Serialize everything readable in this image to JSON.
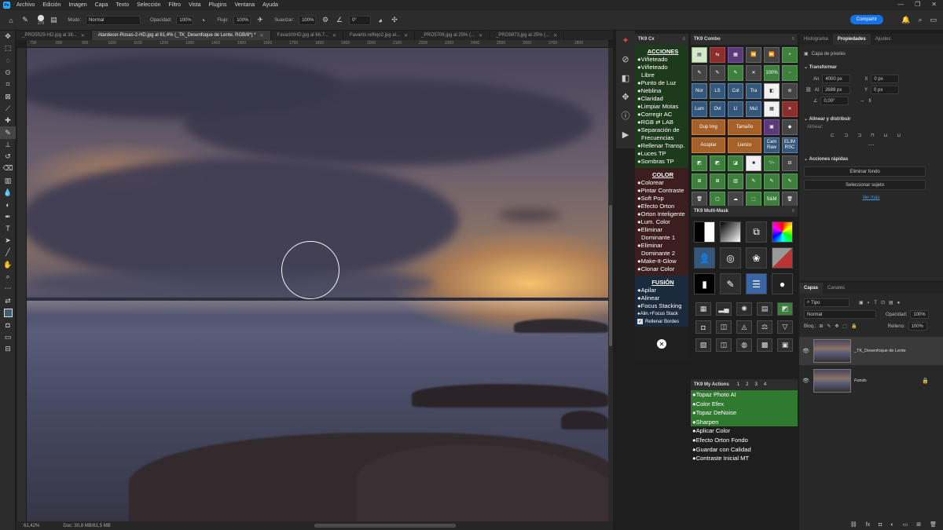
{
  "menubar": {
    "logo": "Ps",
    "items": [
      "Archivo",
      "Edición",
      "Imagen",
      "Capa",
      "Texto",
      "Selección",
      "Filtro",
      "Vista",
      "Plugins",
      "Ventana",
      "Ayuda"
    ]
  },
  "options": {
    "brush_size": "279",
    "mode_label": "Modo:",
    "mode_value": "Normal",
    "opacity_label": "Opacidad:",
    "opacity_value": "100%",
    "flow_label": "Flujo:",
    "flow_value": "100%",
    "smooth_label": "Suavizar:",
    "smooth_value": "100%",
    "angle_value": "0°",
    "share_label": "Compartir"
  },
  "doc_tabs": [
    {
      "label": "_PRO5529-HD.jpg al 38...",
      "active": false
    },
    {
      "label": "Atardecer-Rosas-2-HD.jpg al 61,4% (_TK_Desenfoque de Lente, RGB/8*) *",
      "active": true
    },
    {
      "label": "FavaritXHD.jpg al 66,7...",
      "active": false
    },
    {
      "label": "Favarits-reflejo2.jpg al...",
      "active": false
    },
    {
      "label": "_PRO5706.jpg al 25% (...",
      "active": false
    },
    {
      "label": "_PRO9873.jpg al 25% (...",
      "active": false
    }
  ],
  "ruler_ticks": [
    "700",
    "800",
    "900",
    "1000",
    "1100",
    "1200",
    "1300",
    "1400",
    "1500",
    "1600",
    "1700",
    "1800",
    "1900",
    "2000",
    "2100",
    "2200",
    "2300",
    "2400",
    "2500",
    "2600",
    "2700",
    "2800"
  ],
  "status": {
    "zoom": "61,42%",
    "doc": "Doc: 30,8 MB/61,5 MB"
  },
  "tkcx": {
    "title": "TK9 Cx",
    "acciones_title": "ACCIONES",
    "acciones": [
      "Viñeteado",
      "Viñeteado",
      "Libre",
      "Punto de Luz",
      "Neblina",
      "Claridad",
      "Limpiar Motas",
      "Corregir AC",
      "RGB ⇄ LAB",
      "Separación de",
      "Frecuencias",
      "Rellenar Transp.",
      "Luces TP",
      "Sombras TP"
    ],
    "color_title": "COLOR",
    "color": [
      "Colorear",
      "Pintar Contraste",
      "Soft Pop",
      "Efecto Orton",
      "Orton Inteligente",
      "Lum. Color",
      "Eliminar",
      "Dominante 1",
      "Eliminar",
      "Dominante 2",
      "Make-It-Glow",
      "Clonar Color"
    ],
    "fusion_title": "FUSIÓN",
    "fusion": [
      "Apilar",
      "Alinear",
      "Focus Stacking",
      "Alin.+Focus Stack"
    ],
    "fill_borders": "Rellenar Bordes",
    "close": "✕"
  },
  "combo": {
    "title": "TK9 Combo",
    "buttons": [
      {
        "t": "▤",
        "c": "lgreen"
      },
      {
        "t": "⇆",
        "c": "red"
      },
      {
        "t": "▦",
        "c": "purple"
      },
      {
        "t": "⏪",
        "c": "gray"
      },
      {
        "t": "⏩",
        "c": "gray"
      },
      {
        "t": "+",
        "c": "green"
      },
      {
        "t": "✎",
        "c": "gray"
      },
      {
        "t": "✎",
        "c": "gray"
      },
      {
        "t": "✎",
        "c": "green"
      },
      {
        "t": "✕",
        "c": "gray"
      },
      {
        "t": "100%",
        "c": "green"
      },
      {
        "t": "−",
        "c": "green"
      },
      {
        "t": "Nor",
        "c": "blue"
      },
      {
        "t": "LS",
        "c": "blue"
      },
      {
        "t": "Col",
        "c": "blue"
      },
      {
        "t": "Tra",
        "c": "blue"
      },
      {
        "t": "◧",
        "c": "white"
      },
      {
        "t": "⊘",
        "c": "gray"
      },
      {
        "t": "Lum",
        "c": "blue"
      },
      {
        "t": "Ovl",
        "c": "blue"
      },
      {
        "t": "Ll",
        "c": "blue"
      },
      {
        "t": "Mul",
        "c": "blue"
      },
      {
        "t": "▦",
        "c": "white"
      },
      {
        "t": "✕",
        "c": "red"
      },
      {
        "t": "Dup Img",
        "c": "orange",
        "w": true
      },
      {
        "t": "Tamaño",
        "c": "orange",
        "w": true
      },
      {
        "t": "▣",
        "c": "purple"
      },
      {
        "t": "◆",
        "c": "gray"
      },
      {
        "t": "Acoplar",
        "c": "orange",
        "w": true
      },
      {
        "t": "Lienzo",
        "c": "orange",
        "w": true
      },
      {
        "t": "Cam Raw",
        "c": "blue"
      },
      {
        "t": "ELIM RSC",
        "c": "blue"
      },
      {
        "t": "◩",
        "c": "green"
      },
      {
        "t": "◩",
        "c": "green"
      },
      {
        "t": "◪",
        "c": "green"
      },
      {
        "t": "■",
        "c": "white"
      },
      {
        "t": "⁺∕−",
        "c": "green"
      },
      {
        "t": "⊟",
        "c": "gray"
      },
      {
        "t": "⊞",
        "c": "green"
      },
      {
        "t": "⊞",
        "c": "green"
      },
      {
        "t": "▥",
        "c": "green"
      },
      {
        "t": "✎",
        "c": "green"
      },
      {
        "t": "✎",
        "c": "green"
      },
      {
        "t": "✎",
        "c": "green"
      },
      {
        "t": "🗑",
        "c": "gray"
      },
      {
        "t": "▢",
        "c": "green"
      },
      {
        "t": "☁",
        "c": "gray"
      },
      {
        "t": "⬚",
        "c": "green"
      },
      {
        "t": "S&M",
        "c": "green"
      },
      {
        "t": "🗑",
        "c": "gray"
      },
      {
        "t": "TK▸",
        "c": "red"
      },
      {
        "t": "◉",
        "c": "green"
      },
      {
        "t": "◈",
        "c": "blue"
      },
      {
        "t": "▲",
        "c": "gray"
      },
      {
        "t": "©",
        "c": "gray"
      },
      {
        "t": "⬇",
        "c": "green"
      }
    ]
  },
  "multimask": {
    "title": "TK9 Multi-Mask",
    "top": [
      {
        "t": "",
        "c": "bw"
      },
      {
        "t": "",
        "c": "grad"
      },
      {
        "t": "⧉",
        "c": ""
      },
      {
        "t": "",
        "c": "rainbow"
      },
      {
        "t": "👤",
        "c": "blue"
      },
      {
        "t": "◎",
        "c": ""
      },
      {
        "t": "❀",
        "c": ""
      },
      {
        "t": "",
        "c": "redg"
      },
      {
        "t": "▮",
        "c": "blk"
      },
      {
        "t": "✎",
        "c": ""
      },
      {
        "t": "☰",
        "c": "lblue"
      },
      {
        "t": "●",
        "c": "circ"
      }
    ],
    "bottom": [
      "▦",
      "▂▄",
      "✺",
      "▤",
      "◩",
      "◘",
      "◫",
      "◬",
      "⚖",
      "▽",
      "▧",
      "◫",
      "◍",
      "▩",
      "▣"
    ]
  },
  "myactions": {
    "title": "TK9 My Actions",
    "tabs": [
      "1",
      "2",
      "3",
      "4"
    ],
    "items": [
      {
        "label": "Topaz Photo AI",
        "green": true
      },
      {
        "label": "Color Efex",
        "green": true
      },
      {
        "label": "Topaz DeNoise",
        "green": true
      },
      {
        "label": "Sharpen",
        "green": true
      },
      {
        "label": "Aplicar Color",
        "green": false
      },
      {
        "label": "Efecto Orton Fondo",
        "green": false
      },
      {
        "label": "Guardar con Calidad",
        "green": false
      },
      {
        "label": "Contraste Inicial MT",
        "green": false
      }
    ]
  },
  "props": {
    "tabs": [
      "Histograma",
      "Propiedades",
      "Ajustes"
    ],
    "layer_type": "Capa de píxeles",
    "transform_title": "Transformar",
    "w_label": "An",
    "w_value": "4000 px",
    "x_label": "X",
    "x_value": "0 px",
    "h_label": "Al",
    "h_value": "2689 px",
    "y_label": "Y",
    "y_value": "0 px",
    "angle": "0,00°",
    "align_title": "Alinear y distribuir",
    "align_sub": "Alinear:",
    "quick_title": "Acciones rápidas",
    "btn_remove_bg": "Eliminar fondo",
    "btn_select_subject": "Seleccionar sujeto",
    "see_more": "Ver más"
  },
  "layers": {
    "tabs": [
      "Capas",
      "Canales"
    ],
    "filter": "Tipo",
    "blend": "Normal",
    "opacity_label": "Opacidad:",
    "opacity_value": "100%",
    "lock_label": "Bloq.:",
    "fill_label": "Relleno:",
    "fill_value": "100%",
    "items": [
      {
        "name": "_TK_Desenfoque de Lente",
        "selected": true
      },
      {
        "name": "Fondo",
        "selected": false
      }
    ]
  }
}
